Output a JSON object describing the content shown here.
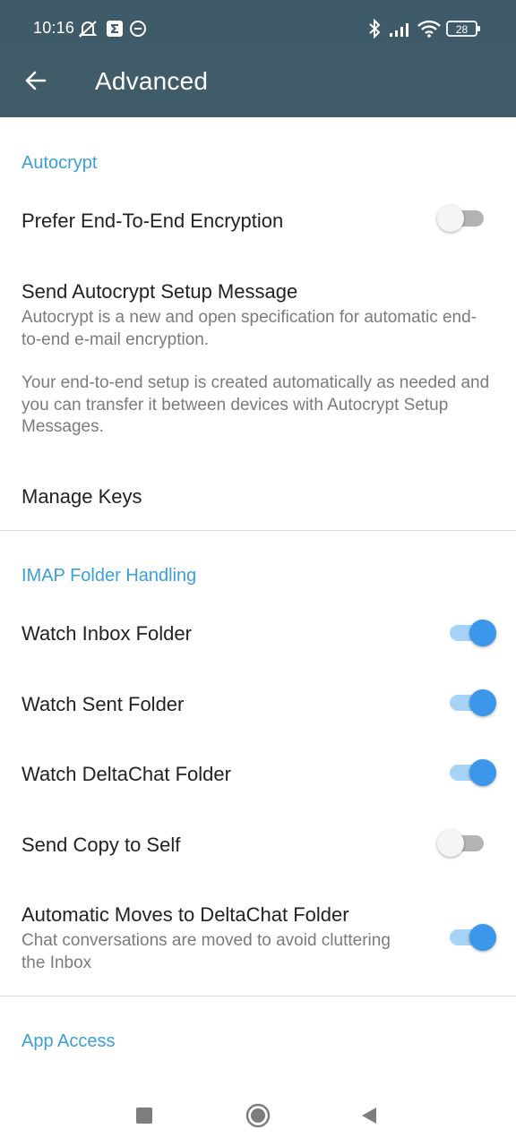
{
  "status_bar": {
    "time": "10:16",
    "battery": "28",
    "icons": [
      "muted-notification-icon",
      "sigma-app-icon",
      "circle-app-icon",
      "bluetooth-icon",
      "signal-icon",
      "wifi-icon",
      "battery-icon"
    ]
  },
  "app_bar": {
    "title": "Advanced",
    "back_icon": "arrow-left-icon"
  },
  "sections": {
    "autocrypt": {
      "header": "Autocrypt",
      "prefer_e2e": {
        "label": "Prefer End-To-End Encryption",
        "enabled": false
      },
      "setup_message": {
        "label": "Send Autocrypt Setup Message",
        "description_1": "Autocrypt is a new and open specification for automatic end-to-end e-mail encryption.",
        "description_2": "Your end-to-end setup is created automatically as needed and you can transfer it between devices with Autocrypt Setup Messages."
      },
      "manage_keys": {
        "label": "Manage Keys"
      }
    },
    "imap": {
      "header": "IMAP Folder Handling",
      "watch_inbox": {
        "label": "Watch Inbox Folder",
        "enabled": true
      },
      "watch_sent": {
        "label": "Watch Sent Folder",
        "enabled": true
      },
      "watch_deltachat": {
        "label": "Watch DeltaChat Folder",
        "enabled": true
      },
      "send_copy": {
        "label": "Send Copy to Self",
        "enabled": false
      },
      "auto_moves": {
        "label": "Automatic Moves to DeltaChat Folder",
        "description": "Chat conversations are moved to avoid cluttering the Inbox",
        "enabled": true
      }
    },
    "app_access": {
      "header": "App Access"
    }
  },
  "colors": {
    "app_bar": "#415c69",
    "accent": "#3b9fd9",
    "switch_on": "#3a97ea"
  },
  "nav_bar": {
    "icons": [
      "recents-square-icon",
      "home-circle-icon",
      "back-triangle-icon"
    ]
  }
}
